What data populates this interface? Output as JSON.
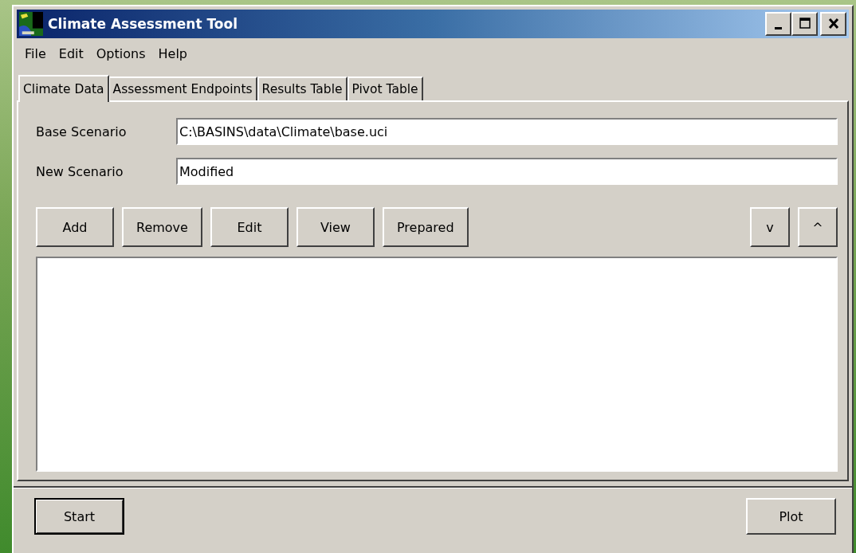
{
  "window": {
    "title": "Climate Assessment Tool"
  },
  "menu": [
    "File",
    "Edit",
    "Options",
    "Help"
  ],
  "tabs": [
    {
      "label": "Climate Data",
      "selected": true
    },
    {
      "label": "Assessment Endpoints",
      "selected": false
    },
    {
      "label": "Results Table",
      "selected": false
    },
    {
      "label": "Pivot Table",
      "selected": false
    }
  ],
  "fields": [
    {
      "label": "Base Scenario",
      "value": "C:\\BASINS\\data\\Climate\\base.uci"
    },
    {
      "label": "New Scenario",
      "value": "Modified"
    }
  ],
  "toolbar_left": [
    "Add",
    "Remove",
    "Edit",
    "View",
    "Prepared"
  ],
  "toolbar_right": [
    "v",
    "^"
  ],
  "footer_buttons": [
    {
      "label": "Start",
      "default": true
    },
    {
      "label": "Plot",
      "default": false
    }
  ]
}
